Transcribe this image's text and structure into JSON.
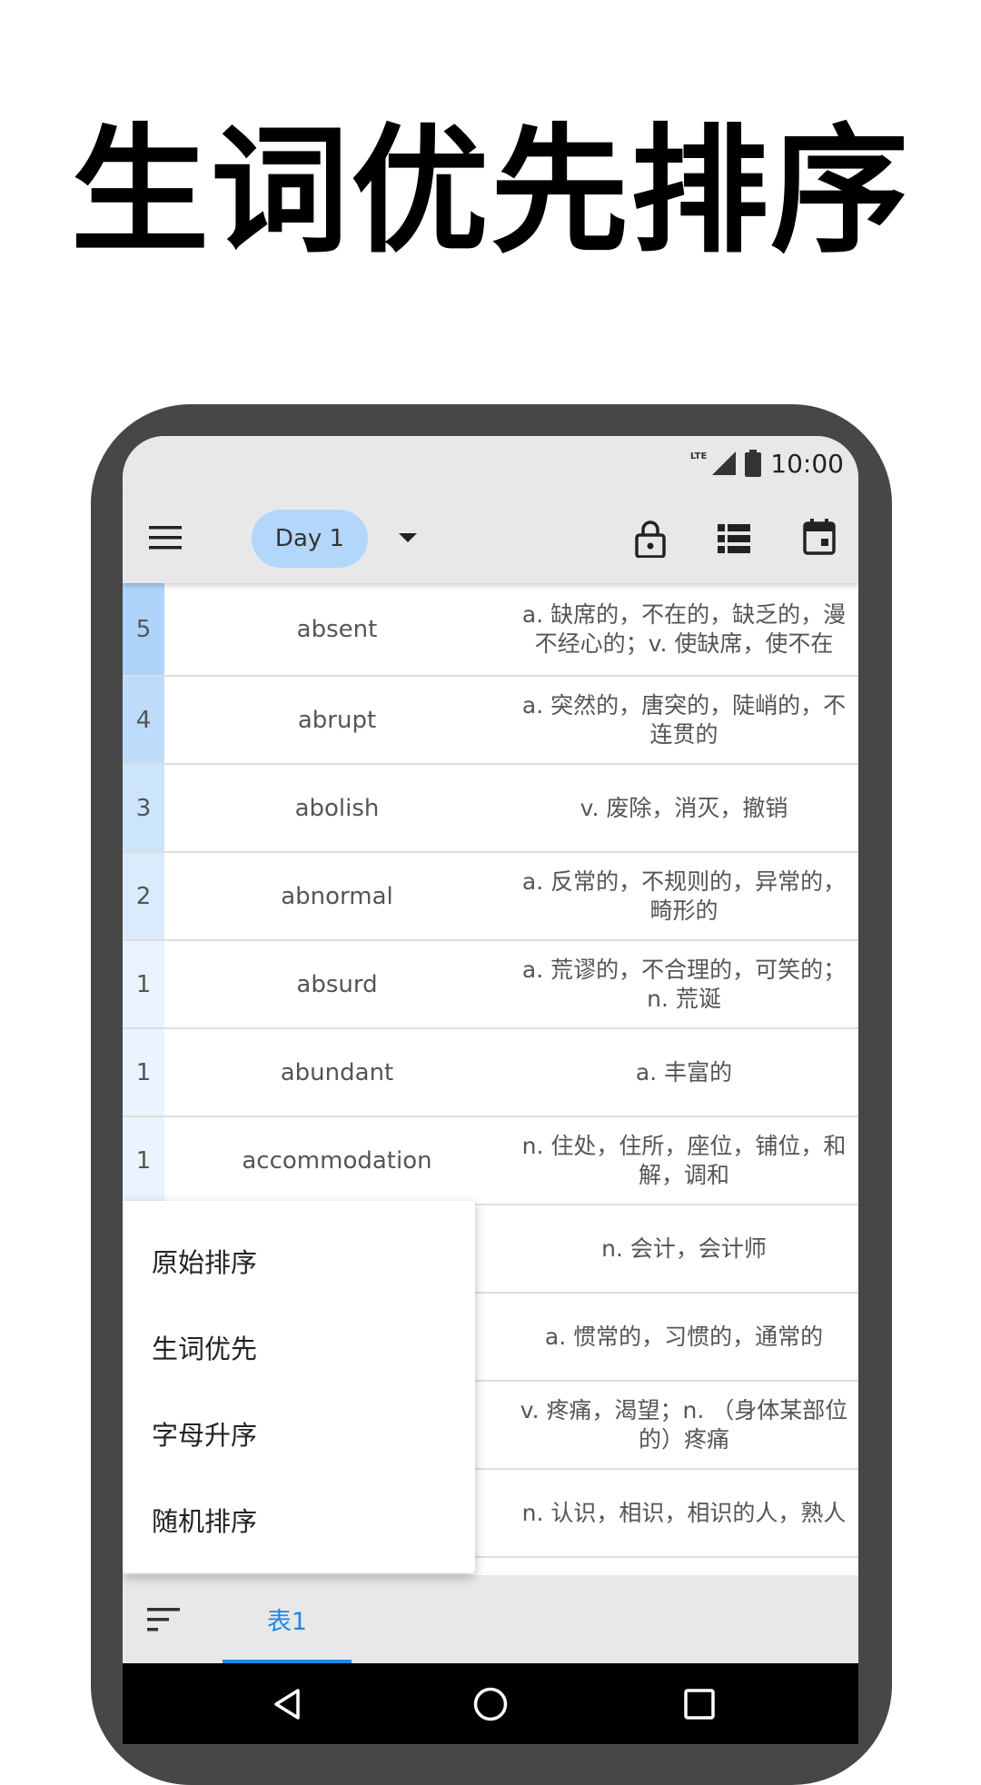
{
  "headline": "生词优先排序",
  "status": {
    "time": "10:00",
    "network": "LTE"
  },
  "appbar": {
    "day_label": "Day 1"
  },
  "rows": [
    {
      "count": "5",
      "word": "absent",
      "definition": "a. 缺席的，不在的，缺乏的，漫不经心的；v. 使缺席，使不在"
    },
    {
      "count": "4",
      "word": "abrupt",
      "definition": "a. 突然的，唐突的，陡峭的，不连贯的"
    },
    {
      "count": "3",
      "word": "abolish",
      "definition": "v. 废除，消灭，撤销"
    },
    {
      "count": "2",
      "word": "abnormal",
      "definition": "a. 反常的，不规则的，异常的，畸形的"
    },
    {
      "count": "1",
      "word": "absurd",
      "definition": "a. 荒谬的，不合理的，可笑的；n. 荒诞"
    },
    {
      "count": "1",
      "word": "abundant",
      "definition": "a. 丰富的"
    },
    {
      "count": "1",
      "word": "accommodation",
      "definition": "n. 住处，住所，座位，铺位，和解，调和"
    },
    {
      "count": "",
      "word": "",
      "definition": "n. 会计，会计师"
    },
    {
      "count": "",
      "word": "",
      "definition": "a. 惯常的，习惯的，通常的"
    },
    {
      "count": "",
      "word": "",
      "definition": "v. 疼痛，渴望；n. （身体某部位的）疼痛"
    },
    {
      "count": "",
      "word": "",
      "definition": "n. 认识，相识，相识的人，熟人"
    }
  ],
  "colors": {
    "count_5": "#aed3fb",
    "count_4": "#bddcfb",
    "count_3": "#cce4fc",
    "count_2": "#daebfd",
    "count_1": "#eaf3fe",
    "accent": "#1e88e5"
  },
  "sort_menu": {
    "items": [
      "原始排序",
      "生词优先",
      "字母升序",
      "随机排序"
    ]
  },
  "bottom_tab": {
    "label": "表1"
  }
}
